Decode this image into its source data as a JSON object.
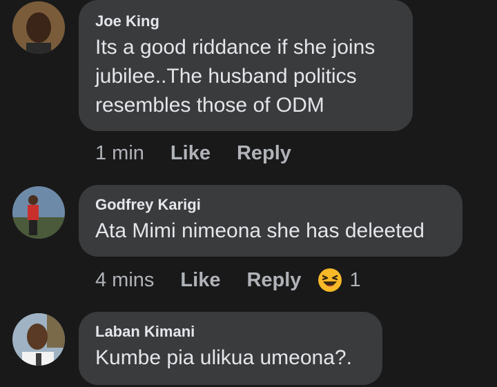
{
  "comments": [
    {
      "author": "Joe King",
      "text": "Its a good riddance if she joins jubilee..The husband politics resembles those of ODM",
      "time": "1 min",
      "like_label": "Like",
      "reply_label": "Reply"
    },
    {
      "author": "Godfrey Karigi",
      "text": "Ata Mimi nimeona she has deleeted",
      "time": "4 mins",
      "like_label": "Like",
      "reply_label": "Reply",
      "reaction_icon": "laughing-emoji-icon",
      "reaction_count": "1"
    },
    {
      "author": "Laban Kimani",
      "text": "Kumbe pia ulikua umeona?."
    }
  ],
  "colors": {
    "background": "#19191a",
    "bubble": "#3a3b3c",
    "primary_text": "#e4e6eb",
    "secondary_text": "#b0b3b8",
    "emoji": "#f7b928"
  }
}
